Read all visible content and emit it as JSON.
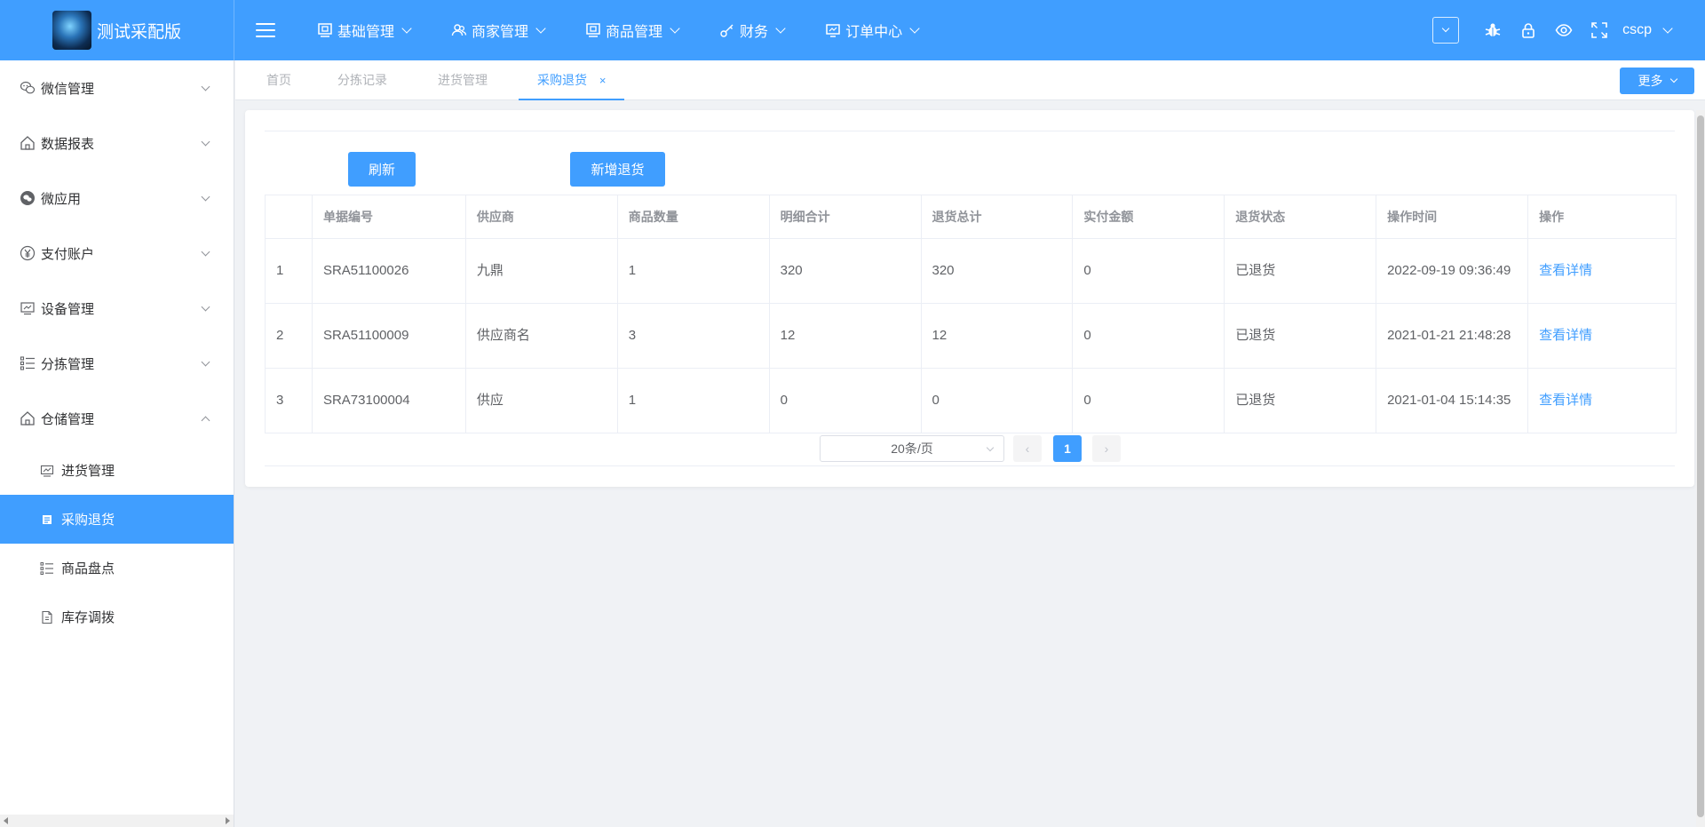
{
  "header": {
    "app_title": "测试采配版",
    "nav": [
      {
        "label": "基础管理",
        "icon": "monitor-icon"
      },
      {
        "label": "商家管理",
        "icon": "users-icon"
      },
      {
        "label": "商品管理",
        "icon": "monitor-icon"
      },
      {
        "label": "财务",
        "icon": "key-icon"
      },
      {
        "label": "订单中心",
        "icon": "monitor-icon"
      }
    ],
    "username": "cscp",
    "icons": [
      "bug-icon",
      "lock-icon",
      "eye-icon",
      "fullscreen-icon"
    ]
  },
  "sidebar": {
    "items": [
      {
        "label": "微信管理",
        "icon": "wechat-icon"
      },
      {
        "label": "数据报表",
        "icon": "home-icon"
      },
      {
        "label": "微应用",
        "icon": "wechat-filled-icon"
      },
      {
        "label": "支付账户",
        "icon": "yen-icon"
      },
      {
        "label": "设备管理",
        "icon": "monitor-icon"
      },
      {
        "label": "分拣管理",
        "icon": "list-icon"
      },
      {
        "label": "仓储管理",
        "icon": "home-icon",
        "expanded": true
      }
    ],
    "subitems": [
      {
        "label": "进货管理",
        "icon": "monitor-icon"
      },
      {
        "label": "采购退货",
        "icon": "doc-icon",
        "active": true
      },
      {
        "label": "商品盘点",
        "icon": "list-icon"
      },
      {
        "label": "库存调拨",
        "icon": "file-icon"
      }
    ]
  },
  "tabs": {
    "items": [
      "首页",
      "分拣记录",
      "进货管理",
      "采购退货"
    ],
    "active": "采购退货",
    "close_glyph": "×",
    "more_label": "更多"
  },
  "toolbar": {
    "refresh_label": "刷新",
    "add_label": "新增退货"
  },
  "table": {
    "columns": [
      "",
      "单据编号",
      "供应商",
      "商品数量",
      "明细合计",
      "退货总计",
      "实付金额",
      "退货状态",
      "操作时间",
      "操作"
    ],
    "rows": [
      {
        "idx": "1",
        "code": "SRA51100026",
        "supplier": "九鼎",
        "qty": "1",
        "detail": "320",
        "total": "320",
        "paid": "0",
        "status": "已退货",
        "time": "2022-09-19 09:36:49",
        "action": "查看详情"
      },
      {
        "idx": "2",
        "code": "SRA51100009",
        "supplier": "供应商名",
        "qty": "3",
        "detail": "12",
        "total": "12",
        "paid": "0",
        "status": "已退货",
        "time": "2021-01-21 21:48:28",
        "action": "查看详情"
      },
      {
        "idx": "3",
        "code": "SRA73100004",
        "supplier": "供应",
        "qty": "1",
        "detail": "0",
        "total": "0",
        "paid": "0",
        "status": "已退货",
        "time": "2021-01-04 15:14:35",
        "action": "查看详情"
      }
    ]
  },
  "pagination": {
    "page_size_label": "20条/页",
    "current_page": "1",
    "prev_glyph": "‹",
    "next_glyph": "›"
  },
  "colors": {
    "primary": "#409eff",
    "background": "#f0f2f5"
  }
}
